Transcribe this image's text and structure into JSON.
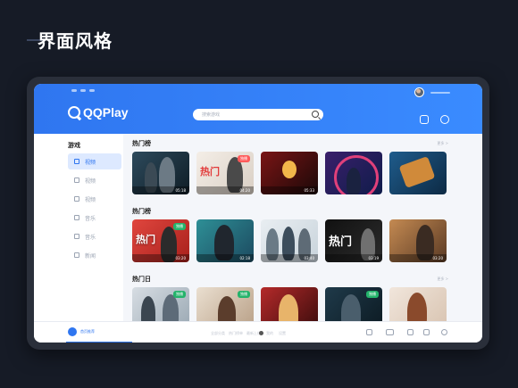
{
  "page": {
    "title": "界面风格"
  },
  "app": {
    "brand": "QQPlay",
    "accent": "#2f76f0"
  },
  "search": {
    "placeholder": "搜索游戏"
  },
  "sidebar": {
    "heading": "游戏",
    "items": [
      {
        "label": "视频",
        "icon": "video-icon",
        "active": true
      },
      {
        "label": "视频",
        "icon": "bag-icon",
        "active": false
      },
      {
        "label": "视频",
        "icon": "box-icon",
        "active": false
      },
      {
        "label": "音乐",
        "icon": "music-icon",
        "active": false
      },
      {
        "label": "音乐",
        "icon": "note-icon",
        "active": false
      },
      {
        "label": "新闻",
        "icon": "news-icon",
        "active": false
      }
    ]
  },
  "sections": [
    {
      "title": "热门榜",
      "more": "更多 >"
    },
    {
      "title": "热门榜",
      "more": ""
    },
    {
      "title": "热门日",
      "more": "更多 >"
    }
  ],
  "row1": [
    {
      "badge": "",
      "big": "",
      "duration": "05:18"
    },
    {
      "badge": "独播",
      "big": "热门",
      "duration": "04:20"
    },
    {
      "badge": "",
      "big": "",
      "duration": "05:33"
    },
    {
      "badge": "",
      "big": "",
      "duration": ""
    },
    {
      "badge": "",
      "big": "",
      "duration": ""
    }
  ],
  "row2": [
    {
      "badge": "独播",
      "big": "热门",
      "duration": "03:20"
    },
    {
      "badge": "",
      "big": "",
      "duration": "02:18"
    },
    {
      "badge": "",
      "big": "",
      "duration": "03:40"
    },
    {
      "badge": "",
      "big": "热门",
      "duration": "03:19"
    },
    {
      "badge": "",
      "big": "",
      "duration": "03:20"
    }
  ],
  "row3": [
    {
      "badge": "独播"
    },
    {
      "badge": "独播"
    },
    {
      "badge": ""
    },
    {
      "badge": "独播"
    },
    {
      "badge": ""
    }
  ],
  "bottom": {
    "home_label": "首页推荐",
    "nav": [
      "全部分类",
      "热门榜单",
      "最新上线",
      "我的",
      "设置"
    ]
  }
}
